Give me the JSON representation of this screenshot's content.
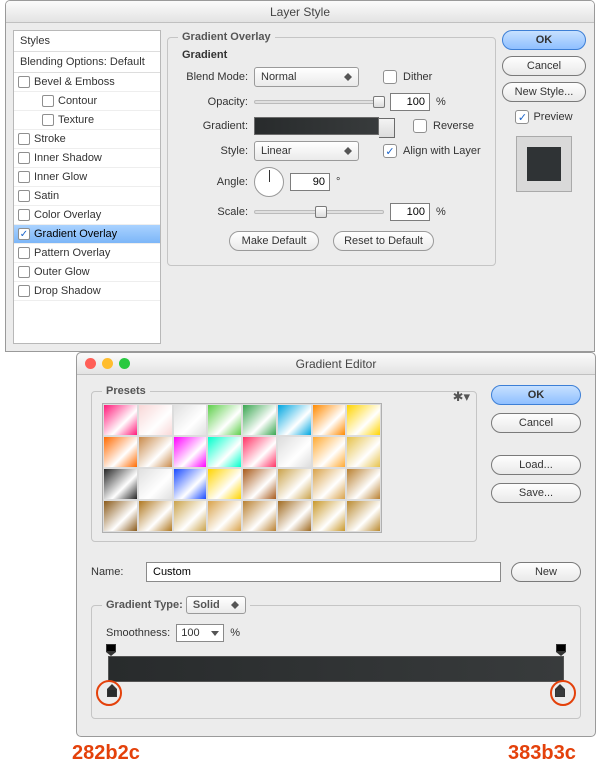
{
  "layerStyle": {
    "title": "Layer Style",
    "sidebar": {
      "styles": "Styles",
      "blending": "Blending Options: Default",
      "items": [
        {
          "label": "Bevel & Emboss",
          "checked": false
        },
        {
          "label": "Contour",
          "checked": false,
          "indent": true
        },
        {
          "label": "Texture",
          "checked": false,
          "indent": true
        },
        {
          "label": "Stroke",
          "checked": false
        },
        {
          "label": "Inner Shadow",
          "checked": false
        },
        {
          "label": "Inner Glow",
          "checked": false
        },
        {
          "label": "Satin",
          "checked": false
        },
        {
          "label": "Color Overlay",
          "checked": false
        },
        {
          "label": "Gradient Overlay",
          "checked": true,
          "selected": true
        },
        {
          "label": "Pattern Overlay",
          "checked": false
        },
        {
          "label": "Outer Glow",
          "checked": false
        },
        {
          "label": "Drop Shadow",
          "checked": false
        }
      ]
    },
    "panel": {
      "group_label": "Gradient Overlay",
      "sub_label": "Gradient",
      "blend_label": "Blend Mode:",
      "blend_value": "Normal",
      "dither_label": "Dither",
      "dither_checked": false,
      "opacity_label": "Opacity:",
      "opacity_value": "100",
      "opacity_pct": "%",
      "gradient_label": "Gradient:",
      "reverse_label": "Reverse",
      "reverse_checked": false,
      "style_label": "Style:",
      "style_value": "Linear",
      "align_label": "Align with Layer",
      "align_checked": true,
      "angle_label": "Angle:",
      "angle_value": "90",
      "angle_deg": "°",
      "scale_label": "Scale:",
      "scale_value": "100",
      "scale_pct": "%",
      "make_default": "Make Default",
      "reset_default": "Reset to Default"
    },
    "right": {
      "ok": "OK",
      "cancel": "Cancel",
      "new_style": "New Style...",
      "preview_label": "Preview",
      "preview_checked": true
    }
  },
  "gradientEditor": {
    "title": "Gradient Editor",
    "presets_label": "Presets",
    "ok": "OK",
    "cancel": "Cancel",
    "load": "Load...",
    "save": "Save...",
    "name_label": "Name:",
    "name_value": "Custom",
    "new": "New",
    "type_label": "Gradient Type:",
    "type_value": "Solid",
    "smooth_label": "Smoothness:",
    "smooth_value": "100",
    "smooth_pct": "%",
    "stop_left_color": "#282b2c",
    "stop_right_color": "#383b3c"
  },
  "annotations": {
    "left_hex": "282b2c",
    "right_hex": "383b3c"
  },
  "preset_colors": [
    [
      "#ff1a7a",
      "#f9d7d7",
      "#e0e0e0",
      "#5ecf4a",
      "#3aa650",
      "#00a6e0",
      "#ff8a00",
      "#ffd400"
    ],
    [
      "#ff6a00",
      "#c98a4a",
      "#ff00ff",
      "#00ffcc",
      "#ff3366",
      "#dcdcdc",
      "#ffaa33",
      "#e6c24a"
    ],
    [
      "#262626",
      "#e0e0e0",
      "#1a4bff",
      "#ffd400",
      "#a85a1a",
      "#caa24a",
      "#d9a24a",
      "#b98030"
    ],
    [
      "#8a5a1a",
      "#b07820",
      "#caa24a",
      "#d9a24a",
      "#b98030",
      "#a06a20",
      "#c9982a",
      "#ba8a30"
    ]
  ]
}
